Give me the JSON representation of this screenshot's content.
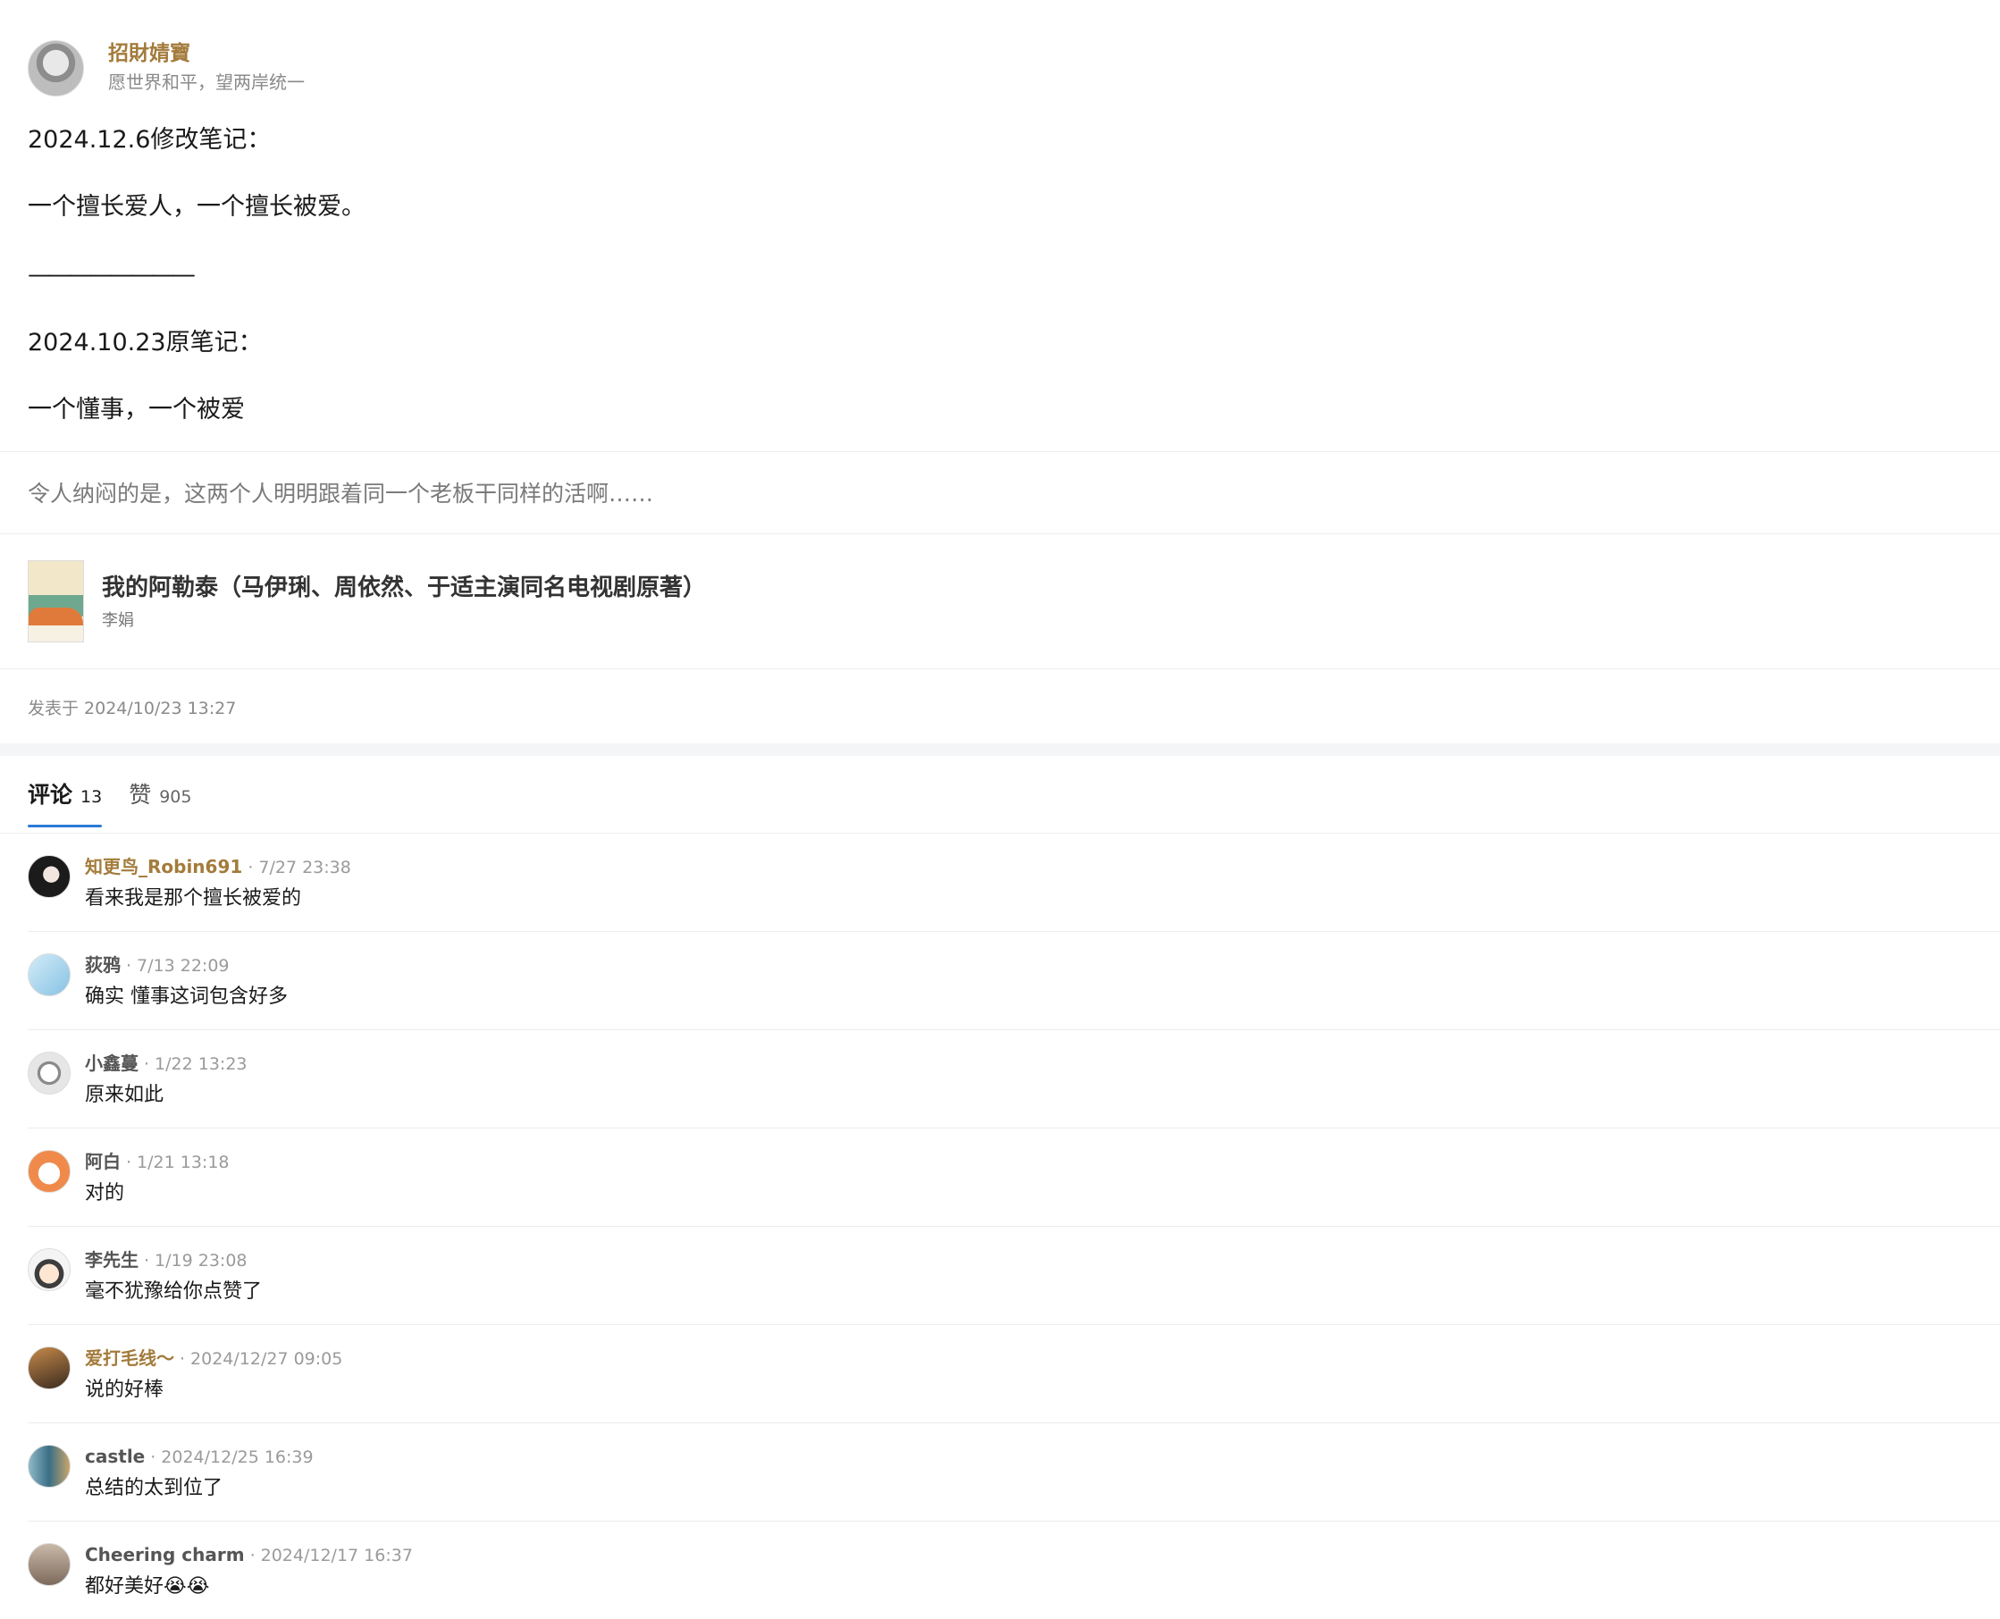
{
  "author": {
    "name": "招財婧寶",
    "signature": "愿世界和平，望两岸统一"
  },
  "note": {
    "line1": "2024.12.6修改笔记：",
    "line2": "一个擅长爱人，一个擅长被爱。",
    "line3": "————————",
    "line4": "2024.10.23原笔记：",
    "line5": "一个懂事，一个被爱"
  },
  "quote": "令人纳闷的是，这两个人明明跟着同一个老板干同样的活啊……",
  "book": {
    "title": "我的阿勒泰（马伊琍、周依然、于适主演同名电视剧原著）",
    "author": "李娟"
  },
  "posted": "发表于 2024/10/23 13:27",
  "tabs": [
    {
      "label": "评论",
      "count": "13"
    },
    {
      "label": "赞",
      "count": "905"
    }
  ],
  "comments": [
    {
      "name": "知更鸟_Robin691",
      "time": "7/27 23:38",
      "text": "看来我是那个擅长被爱的"
    },
    {
      "name": "荻鸦",
      "time": "7/13 22:09",
      "text": "确实 懂事这词包含好多"
    },
    {
      "name": "小鑫蔓",
      "time": "1/22 13:23",
      "text": "原来如此"
    },
    {
      "name": "阿白",
      "time": "1/21 13:18",
      "text": "对的"
    },
    {
      "name": "李先生",
      "time": "1/19 23:08",
      "text": "毫不犹豫给你点赞了"
    },
    {
      "name": "爱打毛线～",
      "time": "2024/12/27 09:05",
      "text": "说的好棒"
    },
    {
      "name": "castle",
      "time": "2024/12/25 16:39",
      "text": "总结的太到位了"
    },
    {
      "name": "Cheering charm",
      "time": "2024/12/17 16:37",
      "text": "都好美好😭😭"
    }
  ],
  "separator": "·",
  "colors": {
    "accent": "#2a7ad7",
    "author_gold": "#a37b3b"
  }
}
